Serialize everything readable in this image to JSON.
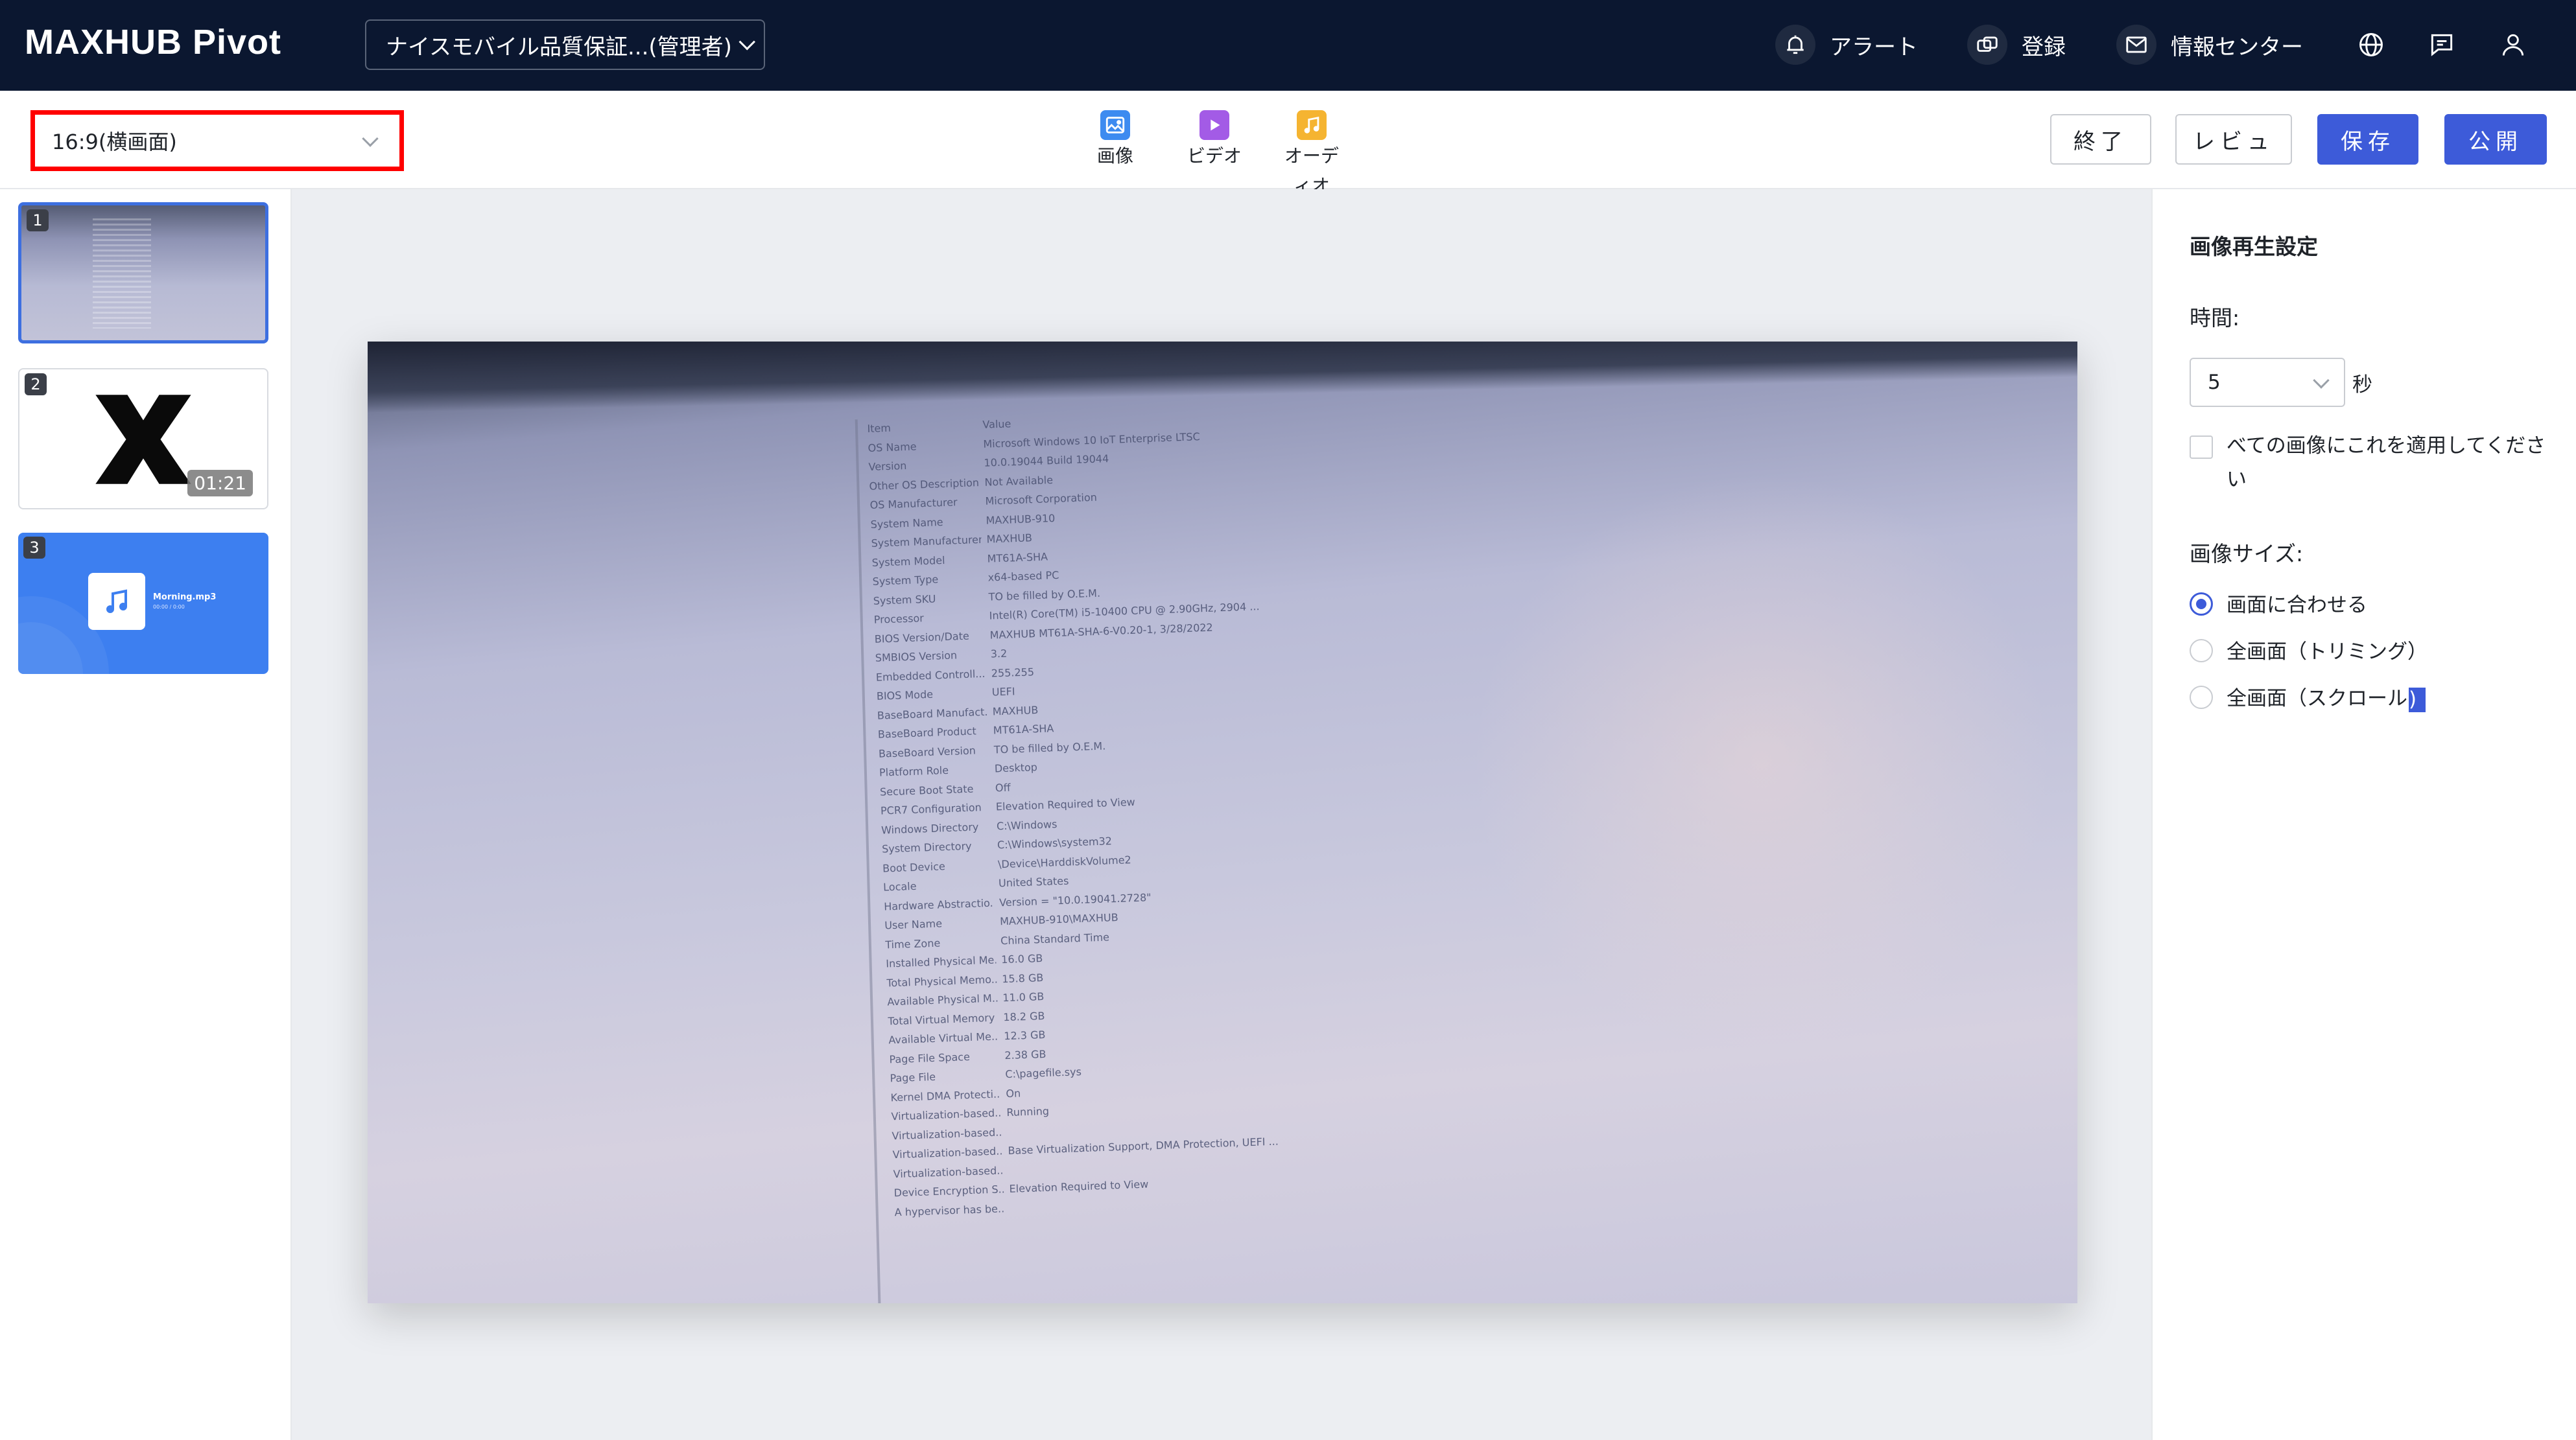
{
  "header": {
    "logo": "MAXHUB Pivot",
    "org_select": "ナイスモバイル品質保証...(管理者)",
    "nav": [
      {
        "label": "アラート",
        "icon": "alert-icon"
      },
      {
        "label": "登録",
        "icon": "register-icon"
      },
      {
        "label": "情報センター",
        "icon": "mail-icon"
      }
    ],
    "icons": [
      "globe-icon",
      "message-icon",
      "user-icon"
    ]
  },
  "toolbar": {
    "ratio_select": "16:9(横画面)",
    "media": [
      {
        "label": "画像",
        "icon": "image-icon",
        "color": "#3d8bf0"
      },
      {
        "label": "ビデオ",
        "icon": "video-icon",
        "color": "#a35be6"
      },
      {
        "label": "オーディオ",
        "icon": "audio-icon",
        "color": "#f5b431"
      }
    ],
    "actions": {
      "exit": "終了",
      "review": "レビュ",
      "save": "保存",
      "publish": "公開"
    }
  },
  "slides": [
    {
      "num": "1",
      "type": "image"
    },
    {
      "num": "2",
      "type": "video",
      "duration": "01:21"
    },
    {
      "num": "3",
      "type": "audio",
      "title": "Morning.mp3",
      "subtitle": "00:00 / 0:00"
    }
  ],
  "canvas": {
    "sysinfo": [
      [
        "Item",
        "Value"
      ],
      [
        "OS Name",
        "Microsoft Windows 10 IoT Enterprise LTSC"
      ],
      [
        "Version",
        "10.0.19044 Build 19044"
      ],
      [
        "Other OS Description",
        "Not Available"
      ],
      [
        "OS Manufacturer",
        "Microsoft Corporation"
      ],
      [
        "System Name",
        "MAXHUB-910"
      ],
      [
        "System Manufacturer",
        "MAXHUB"
      ],
      [
        "System Model",
        "MT61A-SHA"
      ],
      [
        "System Type",
        "x64-based PC"
      ],
      [
        "System SKU",
        "TO be filled by O.E.M."
      ],
      [
        "Processor",
        "Intel(R) Core(TM) i5-10400 CPU @ 2.90GHz, 2904 ..."
      ],
      [
        "BIOS Version/Date",
        "MAXHUB MT61A-SHA-6-V0.20-1, 3/28/2022"
      ],
      [
        "SMBIOS Version",
        "3.2"
      ],
      [
        "Embedded Controll...",
        "255.255"
      ],
      [
        "BIOS Mode",
        "UEFI"
      ],
      [
        "BaseBoard Manufact...",
        "MAXHUB"
      ],
      [
        "BaseBoard Product",
        "MT61A-SHA"
      ],
      [
        "BaseBoard Version",
        "TO be filled by O.E.M."
      ],
      [
        "Platform Role",
        "Desktop"
      ],
      [
        "Secure Boot State",
        "Off"
      ],
      [
        "PCR7 Configuration",
        "Elevation Required to View"
      ],
      [
        "Windows Directory",
        "C:\\Windows"
      ],
      [
        "System Directory",
        "C:\\Windows\\system32"
      ],
      [
        "Boot Device",
        "\\Device\\HarddiskVolume2"
      ],
      [
        "Locale",
        "United States"
      ],
      [
        "Hardware Abstractio...",
        "Version = \"10.0.19041.2728\""
      ],
      [
        "User Name",
        "MAXHUB-910\\MAXHUB"
      ],
      [
        "Time Zone",
        "China Standard Time"
      ],
      [
        "Installed Physical Me...",
        "16.0 GB"
      ],
      [
        "Total Physical Memo...",
        "15.8 GB"
      ],
      [
        "Available Physical M...",
        "11.0 GB"
      ],
      [
        "Total Virtual Memory",
        "18.2 GB"
      ],
      [
        "Available Virtual Me...",
        "12.3 GB"
      ],
      [
        "Page File Space",
        "2.38 GB"
      ],
      [
        "Page File",
        "C:\\pagefile.sys"
      ],
      [
        "Kernel DMA Protecti...",
        "On"
      ],
      [
        "Virtualization-based...",
        "Running"
      ],
      [
        "Virtualization-based...",
        ""
      ],
      [
        "Virtualization-based...",
        "Base Virtualization Support, DMA Protection, UEFI ..."
      ],
      [
        "Virtualization-based...",
        ""
      ],
      [
        "Device Encryption S...",
        "Elevation Required to View"
      ],
      [
        "A hypervisor has be...",
        ""
      ]
    ]
  },
  "settings": {
    "title": "画像再生設定",
    "time_label": "時間:",
    "time_value": "5",
    "time_unit": "秒",
    "apply_all": "べての画像にこれを適用してください",
    "size_label": "画像サイズ:",
    "size_options": [
      "画面に合わせる",
      "全画面（トリミング）",
      "全画面（スクロール"
    ],
    "size_option_tail": ")",
    "selected_index": 0
  },
  "colors": {
    "header_bg": "#0b1730",
    "primary": "#3d5bd9",
    "highlight_border": "#ff0000",
    "canvas_bg": "#eceef2"
  }
}
